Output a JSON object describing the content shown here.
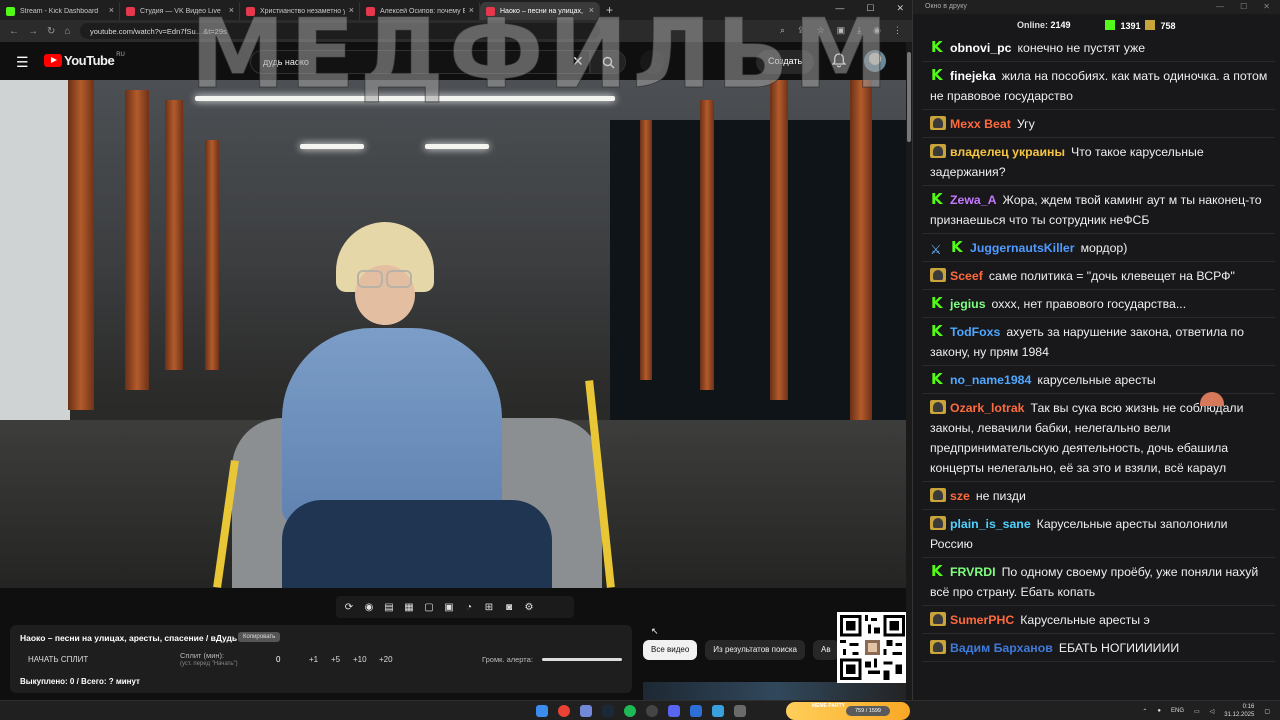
{
  "browser": {
    "tabs": [
      {
        "title": "Stream - Kick Dashboard",
        "color": "#53fc18"
      },
      {
        "title": "Студия — VK Видео Live",
        "color": "#e5384c"
      },
      {
        "title": "Христианство незаметно уходит",
        "color": "#e5384c"
      },
      {
        "title": "Алексей Осипов: почему Бог",
        "color": "#e5384c"
      },
      {
        "title": "Наоко – песни на улицах,",
        "color": "#e5384c",
        "active": true
      }
    ],
    "url": "youtube.com/watch?v=Edn7fSu…&t=29s"
  },
  "youtube": {
    "logo_text": "YouTube",
    "region": "RU",
    "search_value": "дудь наоко",
    "create_label": "Создать"
  },
  "overlay_title": "МЕДФИЛЬМ",
  "stream_panel": {
    "title": "Наоко – песни на улицах, аресты, спасение / вДудь",
    "copy_label": "Копировать",
    "start_split": "НАЧАТЬ СПЛИТ",
    "split_label": "Сплит (мин):",
    "split_hint": "(уст. перед \"Начать\")",
    "split_value": "0",
    "steps": [
      "+1",
      "+5",
      "+10",
      "+20"
    ],
    "volume_label": "Громк. алерта:",
    "bought": "Выкуплено: 0 / Всего: ? минут"
  },
  "chips": [
    "Все видео",
    "Из результатов поиска",
    "Ав"
  ],
  "chat": {
    "window_title": "Окно в друку",
    "online_label": "Online:",
    "online_count": "2149",
    "kick_count": "1391",
    "vk_count": "758",
    "messages": [
      {
        "platform": "kick",
        "user": "obnovi_pc",
        "color": "#ffffff",
        "text": "конечно не пустят уже"
      },
      {
        "platform": "kick",
        "user": "finejeka",
        "color": "#ffffff",
        "text": "жила на пособиях. как мать одиночка. а потом не правовое государство"
      },
      {
        "platform": "vk",
        "user": "Mexx Beat",
        "color": "#ff6a3d",
        "text": "Угу"
      },
      {
        "platform": "vk",
        "user": "владелец украины",
        "color": "#f5c542",
        "text": "Что такое карусельные задержания?"
      },
      {
        "platform": "kick",
        "user": "Zewa_A",
        "color": "#c678ff",
        "text": "Жора, ждем твой каминг аут м ты наконец-то признаешься что ты сотрудник неФСБ"
      },
      {
        "platform": "kick-sword",
        "user": "JuggernautsKiller",
        "color": "#4f9bff",
        "text": "мордор)"
      },
      {
        "platform": "vk",
        "user": "Sceef",
        "color": "#ff6a3d",
        "text": "саме политика = \"дочь клевещет на ВСРФ\""
      },
      {
        "platform": "kick",
        "user": "jegius",
        "color": "#7fff7f",
        "text": "охxx, нет правового государства..."
      },
      {
        "platform": "kick",
        "user": "TodFoxs",
        "color": "#4fa8ff",
        "text": "ахуеть за нарушение закона, ответила по закону, ну прям 1984"
      },
      {
        "platform": "kick",
        "user": "no_name1984",
        "color": "#4fa8ff",
        "text": "карусельные аресты"
      },
      {
        "platform": "vk",
        "user": "Ozark_lotrak",
        "color": "#ff6a3d",
        "text": "Так вы сука всю жизнь не соблюдали законы, левачили бабки, нелегально вели предпринимательскую деятельность, дочь ебашила концерты нелегально, её за это и взяли, всё караул"
      },
      {
        "platform": "vk",
        "user": "sze",
        "color": "#ff6a3d",
        "text": "не пизди"
      },
      {
        "platform": "vk",
        "user": "plain_is_sane",
        "color": "#4fd1ff",
        "text": "Карусельные аресты заполонили Россию"
      },
      {
        "platform": "kick",
        "user": "FRVRDI",
        "color": "#7fff7f",
        "text": "По одному своему проёбу, уже поняли нахуй всё про страну. Ебать копать"
      },
      {
        "platform": "vk",
        "user": "SumerPHC",
        "color": "#ff6a3d",
        "text": "Карусельные аресты э"
      },
      {
        "platform": "vk",
        "user": "Вадим Барханов",
        "color": "#3f7ad9",
        "text": "ЕБАТЬ НОГИИИИИИ"
      }
    ]
  },
  "taskbar": {
    "meme_label": "MEME PARTY",
    "meme_count": "759 / 1599",
    "lang": "ENG",
    "time": "0:16",
    "date": "31.12.2025"
  },
  "colors": {
    "kick_green": "#53fc18",
    "yt_red": "#ff0000",
    "chair_yellow": "#e8c635"
  }
}
